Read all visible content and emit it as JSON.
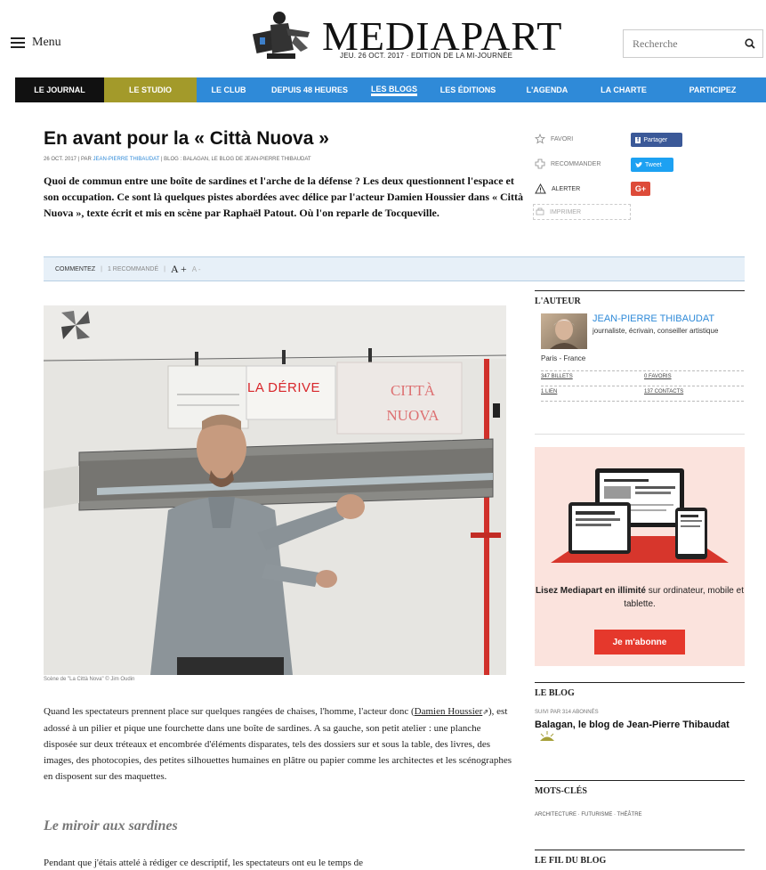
{
  "header": {
    "menu_label": "Menu",
    "logo_text": "MEDIAPART",
    "date_line": "JEU. 26 OCT. 2017 · EDITION DE LA MI-JOURNÉE",
    "search_placeholder": "Recherche"
  },
  "nav": {
    "items": [
      "LE JOURNAL",
      "LE STUDIO",
      "LE CLUB",
      "DEPUIS 48 HEURES",
      "LES BLOGS",
      "LES ÉDITIONS",
      "L'AGENDA",
      "LA CHARTE",
      "PARTICIPEZ"
    ],
    "active": "LES BLOGS"
  },
  "article": {
    "title": "En avant pour la « Città Nuova »",
    "meta_date": "26 OCT. 2017",
    "meta_by": "PAR",
    "meta_author": "JEAN-PIERRE THIBAUDAT",
    "meta_blog": "BLOG : BALAGAN, LE BLOG DE JEAN-PIERRE THIBAUDAT",
    "lede": "Quoi de commun entre une boîte de sardines et l'arche de la défense ? Les deux questionnent l'espace et son occupation. Ce sont là quelques pistes abordées avec délice par l'acteur Damien Houssier dans « Città Nuova », texte écrit et mis en scène par Raphaël Patout. Où l'on reparle de Tocqueville.",
    "photo_sign_1": "LA DÉRIVE",
    "photo_sign_2": "CITTÀ NUOVA",
    "caption": "Scène de \"La Città Nova\" © Jim Oudin",
    "para1_start": "Quand les spectateurs prennent place sur quelques rangées de chaises, l'homme, l'acteur donc (",
    "para1_link": "Damien Houssier",
    "para1_end": "), est adossé à un pilier et pique une fourchette dans une boîte de sardines. A sa gauche, son petit atelier : une planche disposée sur deux tréteaux et encombrée d'éléments disparates, tels des dossiers sur et sous la table, des livres, des images, des photocopies, des petites silhouettes humaines en plâtre ou papier comme les architectes et les scénographes en disposent sur des maquettes.",
    "subhead": "Le miroir aux sardines",
    "para2": "Pendant que j'étais attelé à rédiger ce descriptif, les spectateurs ont eu le temps de"
  },
  "share": {
    "favori": "FAVORI",
    "recommander": "RECOMMANDER",
    "alerter": "ALERTER",
    "imprimer": "IMPRIMER",
    "facebook": "Partager",
    "twitter": "Tweet",
    "google": "G+"
  },
  "toolbar": {
    "comment": "COMMENTEZ",
    "recommends": "1 RECOMMANDÉ",
    "font_plus": "A +",
    "font_minus": "A -"
  },
  "sidebar": {
    "author_head": "L'AUTEUR",
    "author_name": "JEAN-PIERRE THIBAUDAT",
    "author_bio": "journaliste, écrivain, conseiller artistique",
    "author_loc": "Paris - France",
    "billets": "347 BILLETS",
    "favoris": "0 FAVORIS",
    "lien": "1 LIEN",
    "contacts": "137 CONTACTS",
    "promo_bold": "Lisez Mediapart en illimité",
    "promo_rest": " sur ordinateur, mobile et tablette.",
    "promo_button": "Je m'abonne",
    "blog_head": "LE BLOG",
    "blog_sub": "SUIVI PAR 314 ABONNÉS",
    "blog_title": "Balagan, le blog de Jean-Pierre Thibaudat",
    "tags_head": "MOTS-CLÉS",
    "tags": "ARCHITECTURE · FUTURISME · THÉÂTRE",
    "fil_head": "LE FIL DU BLOG"
  },
  "colors": {
    "nav_blue": "#2f8ad8",
    "studio_olive": "#a39a2a",
    "facebook": "#3b5998",
    "twitter": "#1da1f2",
    "google": "#dd4b39",
    "promo_red": "#e5382c"
  }
}
